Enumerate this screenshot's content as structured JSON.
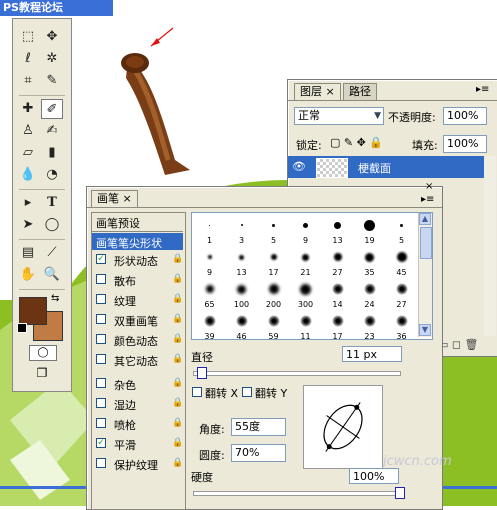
{
  "app": {
    "title": "PS教程论坛"
  },
  "colors": {
    "foreground": "#6b3412",
    "background": "#c17c45",
    "accent": "#316ac5"
  },
  "toolbox": {
    "tools": [
      "marquee-icon",
      "move-icon",
      "lasso-icon",
      "magic-wand-icon",
      "crop-icon",
      "slice-icon",
      "healing-icon",
      "brush-icon",
      "stamp-icon",
      "history-brush-icon",
      "eraser-icon",
      "gradient-icon",
      "blur-icon",
      "dodge-icon",
      "path-select-icon",
      "type-icon",
      "direct-select-icon",
      "shape-icon",
      "notes-icon",
      "eyedropper-icon",
      "hand-icon",
      "zoom-icon"
    ]
  },
  "layers_panel": {
    "tabs": [
      "图层",
      "路径"
    ],
    "blend_mode": "正常",
    "opacity_label": "不透明度:",
    "opacity_value": "100%",
    "lock_label": "锁定:",
    "fill_label": "填充:",
    "fill_value": "100%",
    "layer_name": "梗截面"
  },
  "brush_panel": {
    "tab": "画笔",
    "sidebar_header": "画笔预设",
    "selected_item": "画笔笔尖形状",
    "options": [
      {
        "label": "形状动态",
        "checked": true
      },
      {
        "label": "散布",
        "checked": false
      },
      {
        "label": "纹理",
        "checked": false
      },
      {
        "label": "双重画笔",
        "checked": false
      },
      {
        "label": "颜色动态",
        "checked": false
      },
      {
        "label": "其它动态",
        "checked": false
      },
      {
        "label": "杂色",
        "checked": false
      },
      {
        "label": "湿边",
        "checked": false
      },
      {
        "label": "喷枪",
        "checked": false
      },
      {
        "label": "平滑",
        "checked": true
      },
      {
        "label": "保护纹理",
        "checked": false
      }
    ],
    "presets": [
      "1",
      "3",
      "5",
      "9",
      "13",
      "19",
      "5",
      "9",
      "13",
      "17",
      "21",
      "27",
      "35",
      "45",
      "65",
      "100",
      "200",
      "300",
      "14",
      "24",
      "27",
      "39",
      "46",
      "59",
      "11",
      "17",
      "23",
      "36"
    ],
    "diameter_label": "直径",
    "diameter_value": "11 px",
    "flip_x_label": "翻转 X",
    "flip_y_label": "翻转 Y",
    "angle_label": "角度:",
    "angle_value": "55度",
    "roundness_label": "圆度:",
    "roundness_value": "70%",
    "hardness_label": "硬度",
    "hardness_value": "100%"
  },
  "watermark": {
    "text": "jcwcn.com"
  }
}
